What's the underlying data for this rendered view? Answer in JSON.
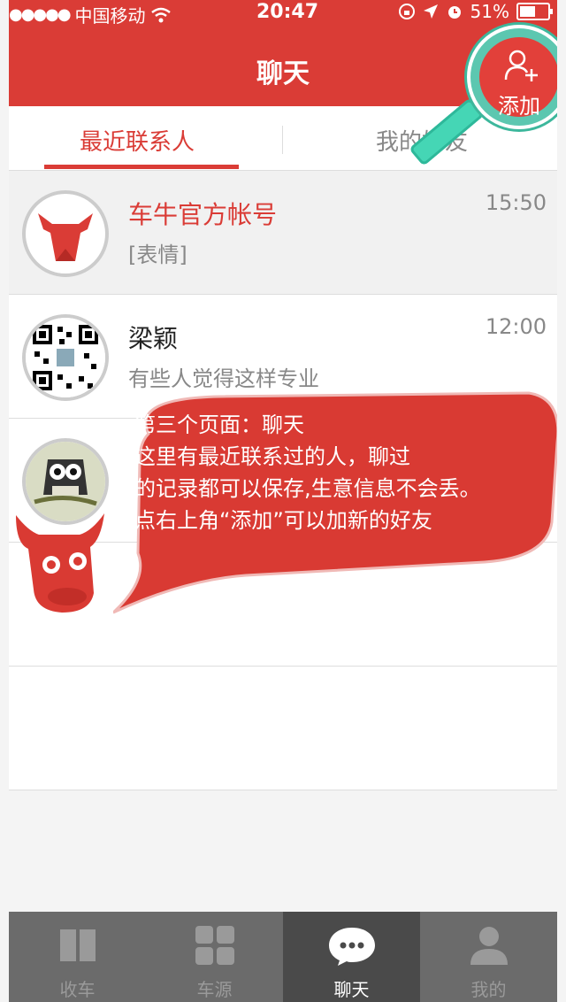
{
  "status_bar": {
    "carrier": "中国移动",
    "time": "20:47",
    "battery": "51%"
  },
  "header": {
    "title": "聊天",
    "add_label": "添加"
  },
  "tabs": [
    {
      "label": "最近联系人",
      "active": true
    },
    {
      "label": "我的好友",
      "active": false
    }
  ],
  "conversations": [
    {
      "name": "车牛官方帐号",
      "preview": "[表情]",
      "time": "15:50"
    },
    {
      "name": "梁颖",
      "preview": "有些人觉得这样专业",
      "time": "12:00"
    }
  ],
  "tooltip": {
    "lines": [
      "第三个页面：聊天",
      "这里有最近联系过的人，聊过",
      "的记录都可以保存,生意信息不会丢。",
      "点右上角“添加”可以加新的好友"
    ]
  },
  "tabbar": [
    {
      "label": "收车",
      "icon": "book-icon"
    },
    {
      "label": "车源",
      "icon": "grid-icon"
    },
    {
      "label": "聊天",
      "icon": "chat-icon",
      "active": true
    },
    {
      "label": "我的",
      "icon": "person-icon"
    }
  ],
  "colors": {
    "brand_red": "#da3c36",
    "tabbar_bg": "#6b6b6b",
    "tabbar_active": "#4a4a4a",
    "magnifier": "#45d6b5"
  }
}
